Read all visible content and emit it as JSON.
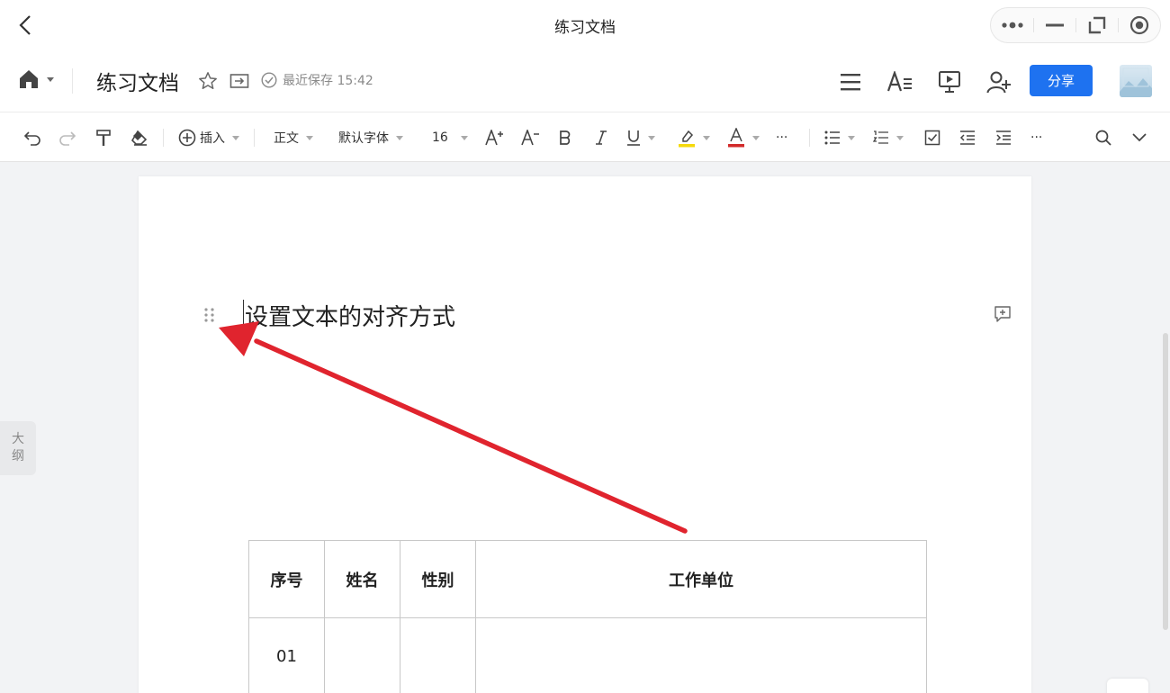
{
  "window": {
    "title": "练习文档"
  },
  "header": {
    "doc_title": "练习文档",
    "save_status": "最近保存 15:42",
    "share_label": "分享"
  },
  "toolbar": {
    "insert_label": "插入",
    "paragraph_style": "正文",
    "font_family": "默认字体",
    "font_size": "16",
    "more_1": "···",
    "more_2": "···",
    "highlight_color": "#f5d90a",
    "font_color": "#d22a2a"
  },
  "document": {
    "heading": "设置文本的对齐方式",
    "table": {
      "headers": [
        "序号",
        "姓名",
        "性别",
        "工作单位"
      ],
      "rows": [
        [
          "01",
          "",
          "",
          ""
        ]
      ]
    }
  },
  "sidebar": {
    "outline_label_1": "大",
    "outline_label_2": "纲"
  },
  "colors": {
    "accent": "#1e72f0",
    "annotation_arrow": "#e0242e"
  }
}
